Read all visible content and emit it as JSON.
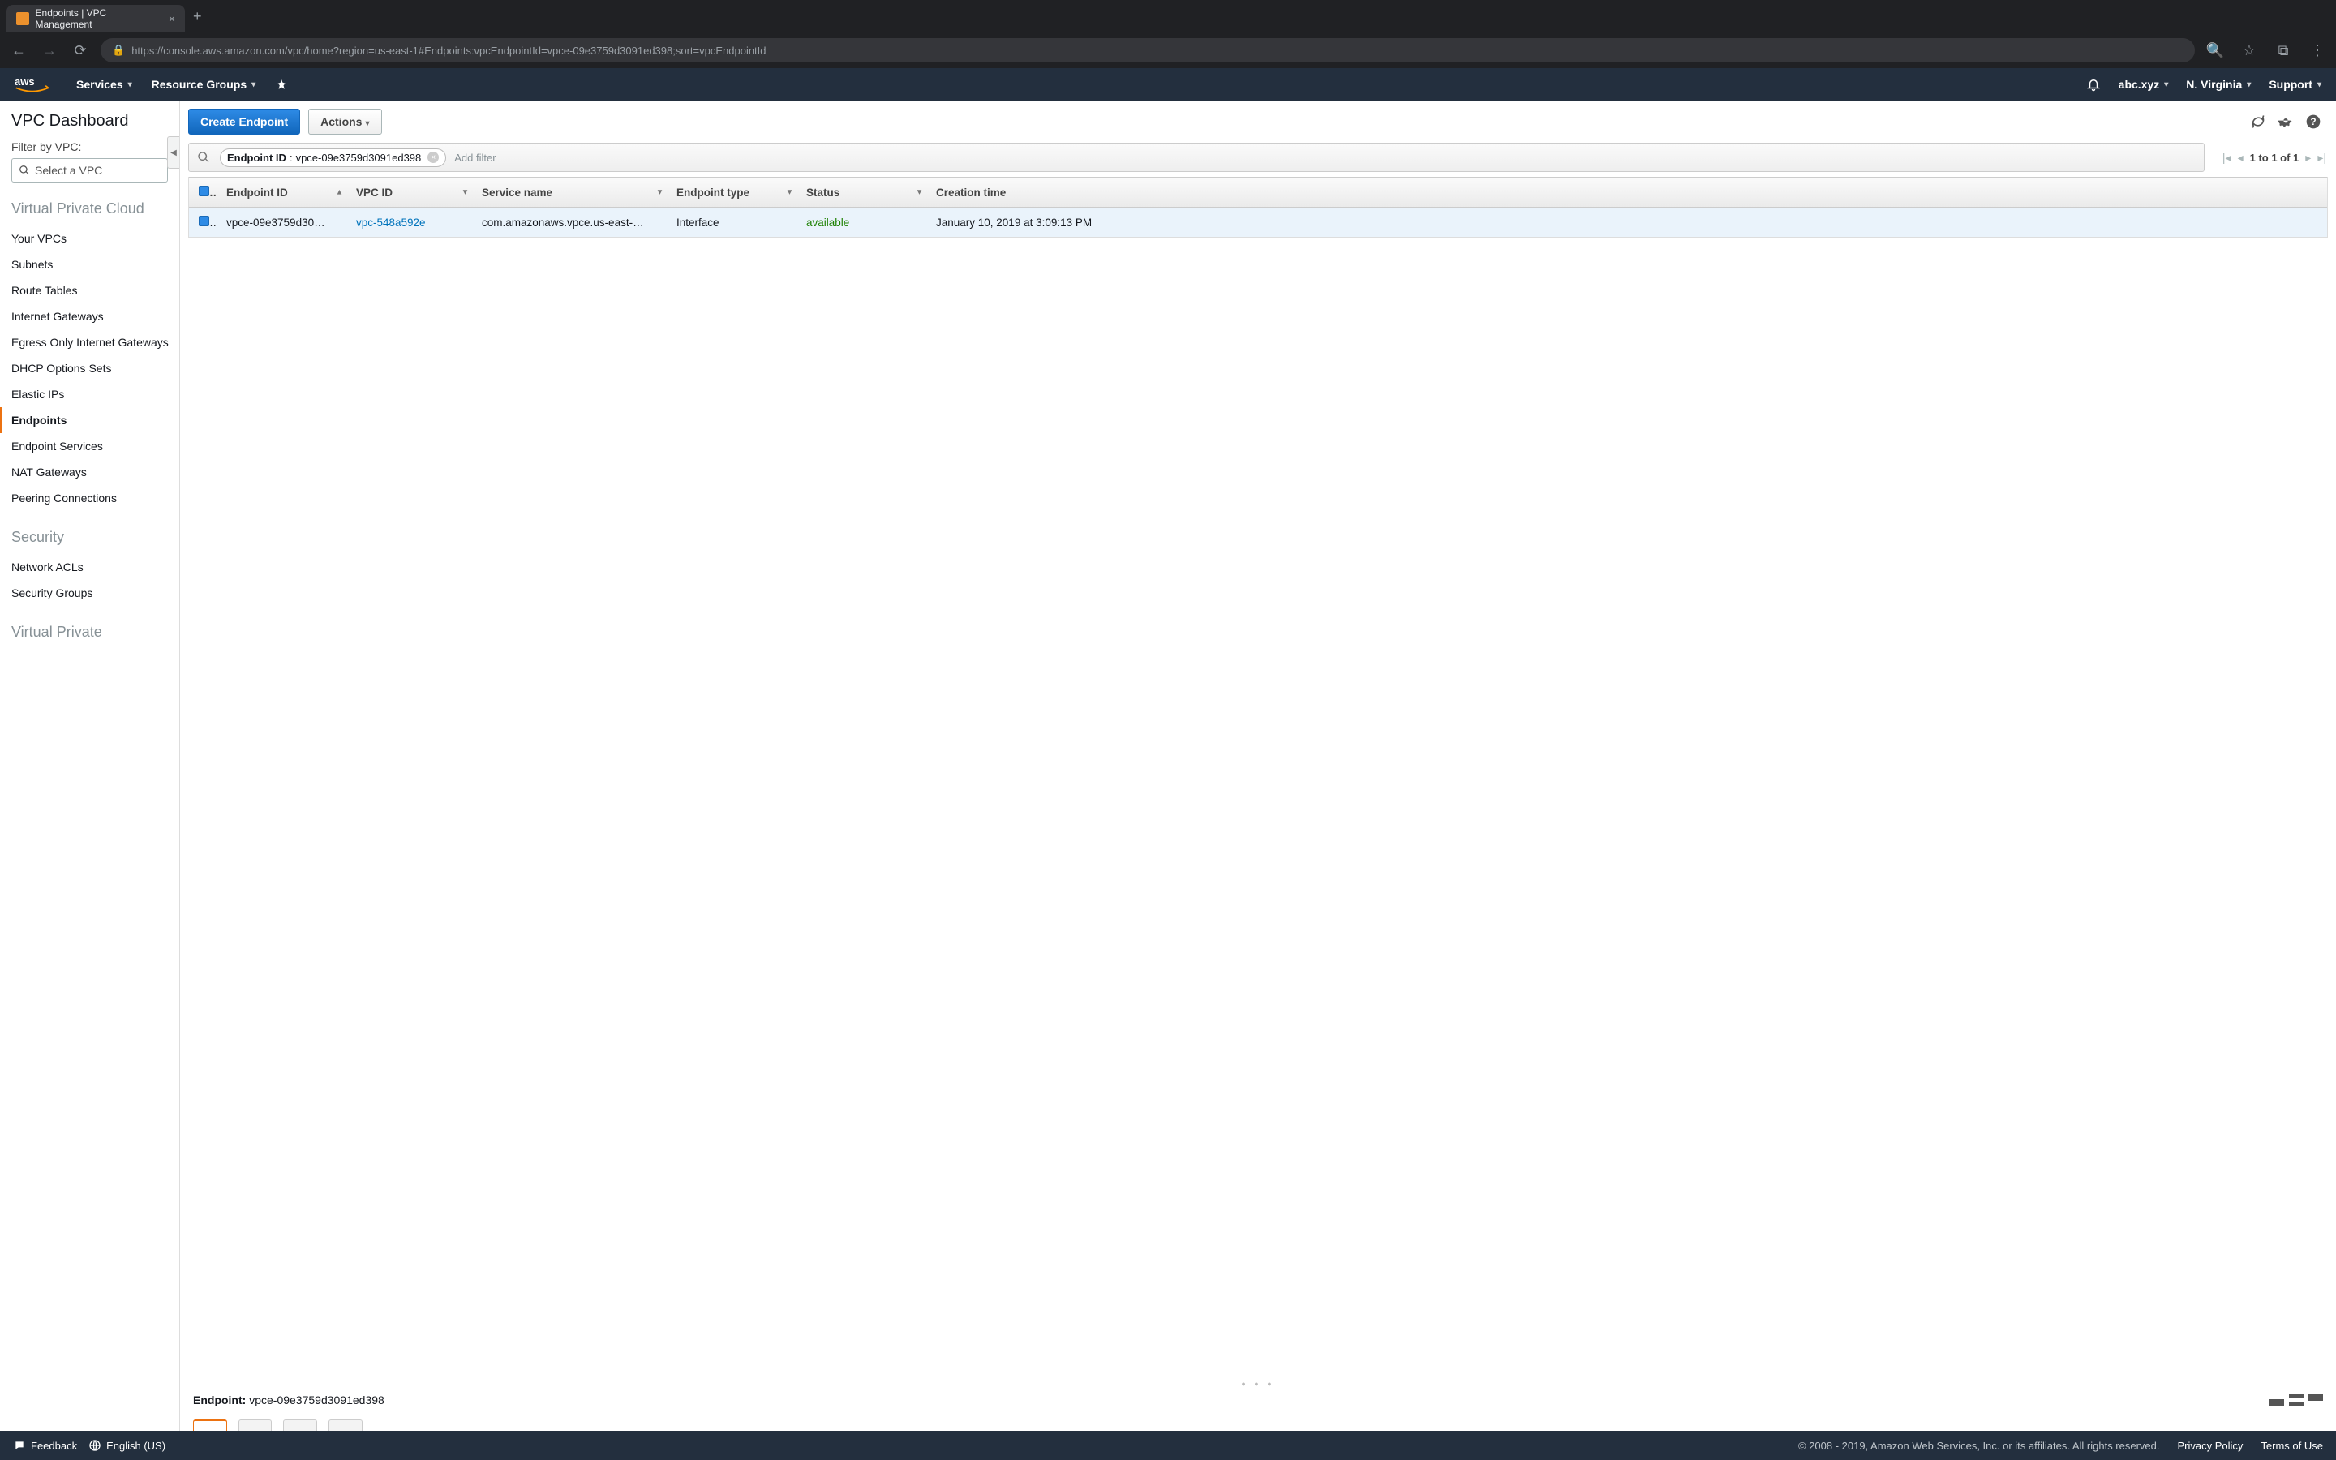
{
  "browser": {
    "tab_title": "Endpoints | VPC Management",
    "url": "https://console.aws.amazon.com/vpc/home?region=us-east-1#Endpoints:vpcEndpointId=vpce-09e3759d3091ed398;sort=vpcEndpointId"
  },
  "nav": {
    "services": "Services",
    "resource_groups": "Resource Groups",
    "account": "abc.xyz",
    "region": "N. Virginia",
    "support": "Support"
  },
  "sidebar": {
    "title": "VPC Dashboard",
    "filter_label": "Filter by VPC:",
    "select_placeholder": "Select a VPC",
    "sections": [
      {
        "title": "Virtual Private Cloud",
        "items": [
          "Your VPCs",
          "Subnets",
          "Route Tables",
          "Internet Gateways",
          "Egress Only Internet Gateways",
          "DHCP Options Sets",
          "Elastic IPs",
          "Endpoints",
          "Endpoint Services",
          "NAT Gateways",
          "Peering Connections"
        ]
      },
      {
        "title": "Security",
        "items": [
          "Network ACLs",
          "Security Groups"
        ]
      },
      {
        "title": "Virtual Private",
        "items": []
      }
    ],
    "active": "Endpoints"
  },
  "toolbar": {
    "create": "Create Endpoint",
    "actions": "Actions"
  },
  "filter": {
    "chip_key": "Endpoint ID",
    "chip_value": "vpce-09e3759d3091ed398",
    "add_filter": "Add filter",
    "page_text": "1 to 1 of 1"
  },
  "table": {
    "columns": [
      "Endpoint ID",
      "VPC ID",
      "Service name",
      "Endpoint type",
      "Status",
      "Creation time"
    ],
    "rows": [
      {
        "endpoint_id": "vpce-09e3759d30…",
        "vpc_id": "vpc-548a592e",
        "service_name": "com.amazonaws.vpce.us-east-…",
        "endpoint_type": "Interface",
        "status": "available",
        "creation_time": "January 10, 2019 at 3:09:13 PM"
      }
    ]
  },
  "detail": {
    "label": "Endpoint:",
    "value": "vpce-09e3759d3091ed398"
  },
  "footer": {
    "feedback": "Feedback",
    "language": "English (US)",
    "copyright": "© 2008 - 2019, Amazon Web Services, Inc. or its affiliates. All rights reserved.",
    "privacy": "Privacy Policy",
    "terms": "Terms of Use"
  }
}
